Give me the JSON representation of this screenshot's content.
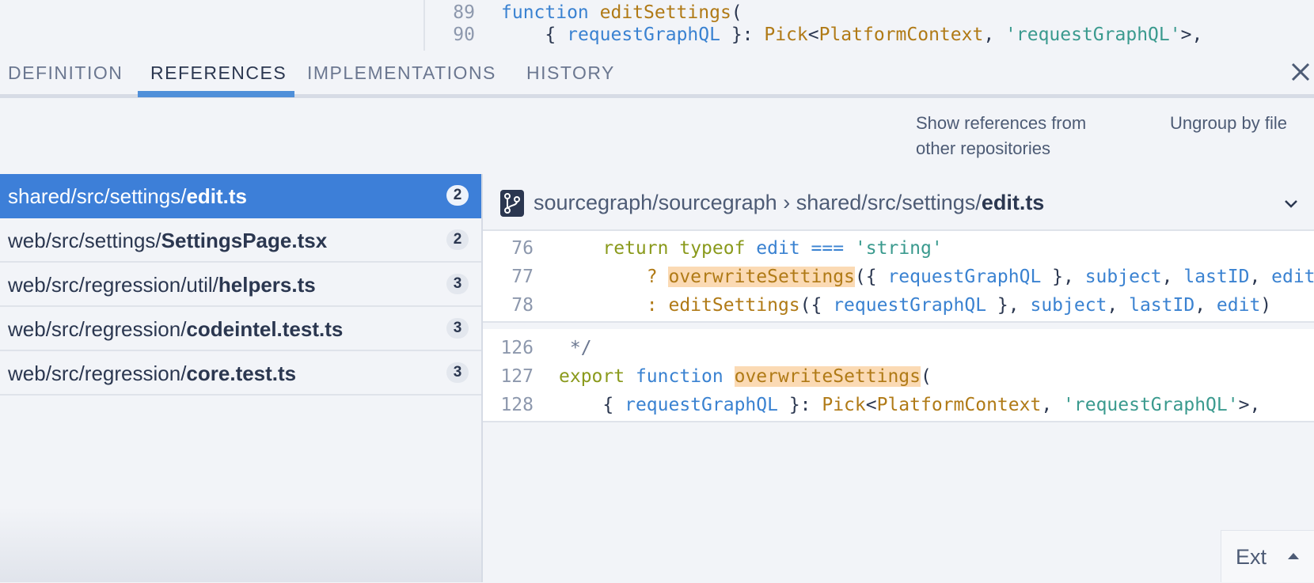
{
  "top_code": [
    {
      "ln": "89",
      "tokens": [
        {
          "t": "function ",
          "c": "kw2"
        },
        {
          "t": "editSettings",
          "c": "fn"
        },
        {
          "t": "(",
          "c": "pun"
        }
      ]
    },
    {
      "ln": "90",
      "tokens": [
        {
          "t": "    { ",
          "c": "pun"
        },
        {
          "t": "requestGraphQL",
          "c": "id"
        },
        {
          "t": " }: ",
          "c": "pun"
        },
        {
          "t": "Pick",
          "c": "fn"
        },
        {
          "t": "<",
          "c": "pun"
        },
        {
          "t": "PlatformContext",
          "c": "fn"
        },
        {
          "t": ", ",
          "c": "pun"
        },
        {
          "t": "'requestGraphQL'",
          "c": "str"
        },
        {
          "t": ">,",
          "c": "pun"
        }
      ]
    }
  ],
  "tabs": [
    {
      "label": "DEFINITION",
      "active": false
    },
    {
      "label": "REFERENCES",
      "active": true
    },
    {
      "label": "IMPLEMENTATIONS",
      "active": false
    },
    {
      "label": "HISTORY",
      "active": false
    }
  ],
  "toolbar": {
    "show_refs_line1": "Show references from",
    "show_refs_line2": "other repositories",
    "ungroup_label": "Ungroup by file"
  },
  "files": [
    {
      "dir": "shared/src/settings/",
      "name": "edit.ts",
      "count": "2",
      "selected": true
    },
    {
      "dir": "web/src/settings/",
      "name": "SettingsPage.tsx",
      "count": "2",
      "selected": false
    },
    {
      "dir": "web/src/regression/util/",
      "name": "helpers.ts",
      "count": "3",
      "selected": false
    },
    {
      "dir": "web/src/regression/",
      "name": "codeintel.test.ts",
      "count": "3",
      "selected": false
    },
    {
      "dir": "web/src/regression/",
      "name": "core.test.ts",
      "count": "3",
      "selected": false
    }
  ],
  "repo_header": {
    "repo": "sourcegraph/sourcegraph",
    "separator": " › ",
    "dir": "shared/src/settings/",
    "file": "edit.ts"
  },
  "snippets": [
    {
      "lines": [
        {
          "ln": "76",
          "tokens": [
            {
              "t": "    ",
              "c": "pun"
            },
            {
              "t": "return",
              "c": "kw"
            },
            {
              "t": " ",
              "c": "pun"
            },
            {
              "t": "typeof",
              "c": "kw"
            },
            {
              "t": " ",
              "c": "pun"
            },
            {
              "t": "edit",
              "c": "id"
            },
            {
              "t": " === ",
              "c": "id"
            },
            {
              "t": "'string'",
              "c": "str"
            }
          ]
        },
        {
          "ln": "77",
          "tokens": [
            {
              "t": "        ",
              "c": "pun"
            },
            {
              "t": "? ",
              "c": "fn"
            },
            {
              "t": "overwriteSettings",
              "c": "hl"
            },
            {
              "t": "({ ",
              "c": "pun"
            },
            {
              "t": "requestGraphQL",
              "c": "id"
            },
            {
              "t": " }, ",
              "c": "pun"
            },
            {
              "t": "subject",
              "c": "id"
            },
            {
              "t": ", ",
              "c": "pun"
            },
            {
              "t": "lastID",
              "c": "id"
            },
            {
              "t": ", ",
              "c": "pun"
            },
            {
              "t": "edit",
              "c": "id"
            },
            {
              "t": ")",
              "c": "pun"
            }
          ]
        },
        {
          "ln": "78",
          "tokens": [
            {
              "t": "        ",
              "c": "pun"
            },
            {
              "t": ": ",
              "c": "fn"
            },
            {
              "t": "editSettings",
              "c": "fn"
            },
            {
              "t": "({ ",
              "c": "pun"
            },
            {
              "t": "requestGraphQL",
              "c": "id"
            },
            {
              "t": " }, ",
              "c": "pun"
            },
            {
              "t": "subject",
              "c": "id"
            },
            {
              "t": ", ",
              "c": "pun"
            },
            {
              "t": "lastID",
              "c": "id"
            },
            {
              "t": ", ",
              "c": "pun"
            },
            {
              "t": "edit",
              "c": "id"
            },
            {
              "t": ")",
              "c": "pun"
            }
          ]
        }
      ]
    },
    {
      "lines": [
        {
          "ln": "126",
          "tokens": [
            {
              "t": " */",
              "c": "cmt"
            }
          ]
        },
        {
          "ln": "127",
          "tokens": [
            {
              "t": "export",
              "c": "kw"
            },
            {
              "t": " ",
              "c": "pun"
            },
            {
              "t": "function",
              "c": "kw2"
            },
            {
              "t": " ",
              "c": "pun"
            },
            {
              "t": "overwriteSettings",
              "c": "hl"
            },
            {
              "t": "(",
              "c": "pun"
            }
          ]
        },
        {
          "ln": "128",
          "tokens": [
            {
              "t": "    { ",
              "c": "pun"
            },
            {
              "t": "requestGraphQL",
              "c": "id"
            },
            {
              "t": " }: ",
              "c": "pun"
            },
            {
              "t": "Pick",
              "c": "fn"
            },
            {
              "t": "<",
              "c": "pun"
            },
            {
              "t": "PlatformContext",
              "c": "fn"
            },
            {
              "t": ", ",
              "c": "pun"
            },
            {
              "t": "'requestGraphQL'",
              "c": "str"
            },
            {
              "t": ">,",
              "c": "pun"
            }
          ]
        }
      ]
    }
  ],
  "ext_button": {
    "label": "Ext"
  },
  "colors": {
    "accent": "#3d7fd8",
    "highlight": "#fbdab4"
  }
}
